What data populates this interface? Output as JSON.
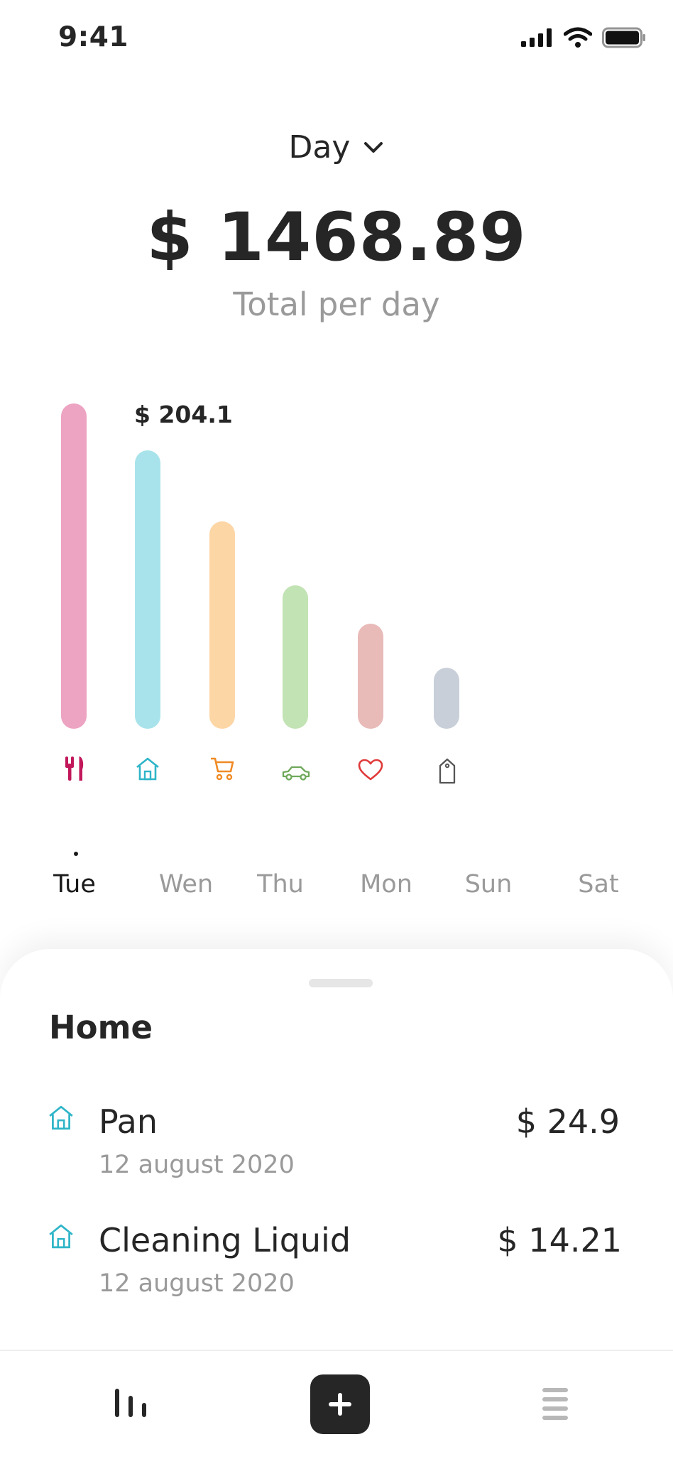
{
  "status_bar": {
    "time": "9:41"
  },
  "header": {
    "period_label": "Day",
    "total": "$ 1468.89",
    "total_caption": "Total per day"
  },
  "chart_data": {
    "type": "bar",
    "categories": [
      "food",
      "home",
      "shopping",
      "transport",
      "health",
      "other"
    ],
    "values": [
      229,
      196,
      146,
      101,
      74,
      43
    ],
    "highlight_label": "$ 204.1",
    "colors": [
      "#EDA3C2",
      "#A8E3EB",
      "#FDD6A6",
      "#C2E3B4",
      "#E8BAB8",
      "#C9CFD8"
    ],
    "icon_colors": [
      "#C2185B",
      "#2FB5C8",
      "#F08A24",
      "#6FA85A",
      "#E03A3A",
      "#555555"
    ]
  },
  "days": [
    {
      "label": "Tue",
      "active": true
    },
    {
      "label": "Wen",
      "active": false
    },
    {
      "label": "Thu",
      "active": false
    },
    {
      "label": "Mon",
      "active": false
    },
    {
      "label": "Sun",
      "active": false
    },
    {
      "label": "Sat",
      "active": false
    }
  ],
  "sheet": {
    "title": "Home",
    "items": [
      {
        "name": "Pan",
        "date": "12 august 2020",
        "amount": "$ 24.9",
        "icon": "home-icon"
      },
      {
        "name": "Cleaning Liquid",
        "date": "12 august 2020",
        "amount": "$ 14.21",
        "icon": "home-icon"
      }
    ]
  },
  "tabbar": {
    "items": [
      "stats-icon",
      "add-icon",
      "menu-icon"
    ]
  }
}
